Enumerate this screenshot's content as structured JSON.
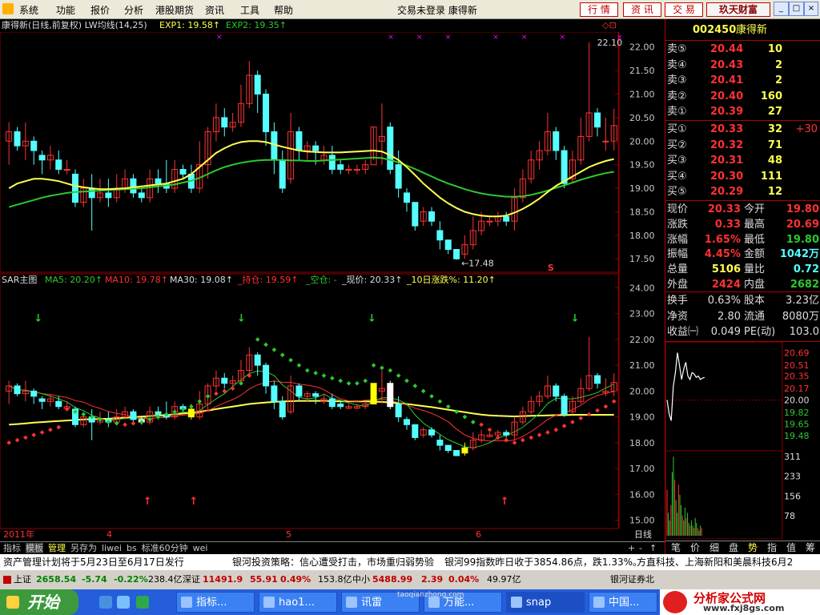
{
  "menu": {
    "items": [
      "系统",
      "功能",
      "报价",
      "分析",
      "港股期货",
      "资讯",
      "工具",
      "帮助"
    ],
    "center_text": "交易未登录  康得新",
    "buttons": [
      "行 情",
      "资 讯",
      "交 易"
    ],
    "brand": "玖天财富",
    "window_controls": [
      "_",
      "□",
      "×"
    ]
  },
  "chart_header": {
    "title": "康得新(日线,前复权) LW均线(14,25)",
    "exp1": "EXP1: 19.58↑",
    "exp2": "EXP2: 19.35↑",
    "corner_marks": "◇⊡",
    "max_label": "22.10",
    "min_label": "←17.48",
    "s_marker": "S"
  },
  "sar_header": {
    "title": "SAR主图",
    "ma5": "MA5: 20.20↑",
    "ma10": "MA10: 19.78↑",
    "ma30": "MA30: 19.08↑",
    "hold": "_持仓: 19.59↑",
    "empty": "_空仓: -",
    "price": "_现价: 20.33↑",
    "pct10": "_10日涨跌%: 11.20↑"
  },
  "axis": {
    "upper_ticks": [
      "22.00",
      "21.50",
      "21.00",
      "20.50",
      "20.00",
      "19.50",
      "19.00",
      "18.50",
      "18.00",
      "17.50"
    ],
    "lower_ticks": [
      "24.00",
      "23.00",
      "22.00",
      "21.00",
      "20.00",
      "19.00",
      "18.00",
      "17.00",
      "16.00",
      "15.00"
    ],
    "time_labels": [
      "2011年",
      "4",
      "5",
      "6"
    ],
    "timeframe": "日线",
    "nav_buttons": [
      "+",
      "-",
      "↑",
      "↓"
    ]
  },
  "bottom_tabs": [
    "指标",
    "模板",
    "管理",
    "另存为",
    "liwei",
    "bs",
    "标准60分钟",
    "wei"
  ],
  "quote": {
    "code": "002450",
    "name": "康得新",
    "asks": [
      {
        "label": "卖⑤",
        "price": "20.44",
        "vol": "10"
      },
      {
        "label": "卖④",
        "price": "20.43",
        "vol": "2"
      },
      {
        "label": "卖③",
        "price": "20.41",
        "vol": "2"
      },
      {
        "label": "卖②",
        "price": "20.40",
        "vol": "160"
      },
      {
        "label": "卖①",
        "price": "20.39",
        "vol": "27"
      }
    ],
    "bids": [
      {
        "label": "买①",
        "price": "20.33",
        "vol": "32",
        "chg": "+30"
      },
      {
        "label": "买②",
        "price": "20.32",
        "vol": "71",
        "chg": ""
      },
      {
        "label": "买③",
        "price": "20.31",
        "vol": "48",
        "chg": ""
      },
      {
        "label": "买④",
        "price": "20.30",
        "vol": "111",
        "chg": ""
      },
      {
        "label": "买⑤",
        "price": "20.29",
        "vol": "12",
        "chg": ""
      }
    ],
    "stats": [
      {
        "l1": "现价",
        "v1": "20.33",
        "l2": "今开",
        "v2": "19.80"
      },
      {
        "l1": "涨跌",
        "v1": "0.33",
        "l2": "最高",
        "v2": "20.69"
      },
      {
        "l1": "涨幅",
        "v1": "1.65%",
        "l2": "最低",
        "v2": "19.80"
      },
      {
        "l1": "振幅",
        "v1": "4.45%",
        "l2": "金额",
        "v2": "1042万"
      },
      {
        "l1": "总量",
        "v1": "5106",
        "l2": "量比",
        "v2": "0.72"
      },
      {
        "l1": "外盘",
        "v1": "2424",
        "l2": "内盘",
        "v2": "2682"
      }
    ],
    "fund": [
      {
        "l1": "换手",
        "v1": "0.63%",
        "l2": "股本",
        "v2": "3.23亿"
      },
      {
        "l1": "净资",
        "v1": "2.80",
        "l2": "流通",
        "v2": "8080万"
      },
      {
        "l1": "收益㈠",
        "v1": "0.049",
        "l2": "PE(动)",
        "v2": "103.0"
      }
    ],
    "mini_ticks": [
      "20.69",
      "20.51",
      "20.35",
      "20.17",
      "20.00",
      "19.82",
      "19.65",
      "19.48"
    ],
    "mini_vol_ticks": [
      "311",
      "233",
      "156",
      "78"
    ],
    "tabs": [
      "笔",
      "价",
      "细",
      "盘",
      "势",
      "指",
      "值",
      "筹"
    ]
  },
  "ticker": [
    "资产管理计划将于5月23日至6月17日发行",
    "银河投资策略：信心遭受打击，市场重归弱势验",
    "银河99指数昨日收于3854.86点，跌1.33%。",
    "方直科技、上海新阳和美晨科技6月2"
  ],
  "status": {
    "sh_label": "上证",
    "sh_val": "2658.54",
    "sh_chg": "-5.74",
    "sh_pct": "-0.22%",
    "sh_amt": "238.4亿",
    "sz_label": "深证",
    "sz_val": "11491.9",
    "sz_chg": "55.91",
    "sz_pct": "0.49%",
    "sz_amt": "153.8亿",
    "zx_label": "中小",
    "zx_val": "5488.99",
    "zx_chg": "2.39",
    "zx_pct": "0.04%",
    "zx_amt": "49.97亿",
    "broker": "银河证券北"
  },
  "taskbar": {
    "start": "开始",
    "tasks": [
      "指标...",
      "hao1...",
      "讯雷",
      "万能...",
      "snap",
      "中国..."
    ],
    "watermark_title": "分析家公式网",
    "watermark_url": "www.fxj8gs.com",
    "site_mark": "taoqianzhong.com"
  },
  "colors": {
    "up": "#ff3232",
    "down": "#54ffff",
    "ma_yellow": "#ffff50",
    "ma_green": "#2ec82e",
    "ma_white": "#ffffff",
    "ma_purple": "#ff00ff",
    "accent": "#c00000"
  },
  "chart_data": {
    "type": "candlestick",
    "title": "康得新(日线,前复权)",
    "candles": [
      [
        20.0,
        20.2,
        20.4,
        19.5
      ],
      [
        20.2,
        19.9,
        20.3,
        19.8
      ],
      [
        19.9,
        20.0,
        20.4,
        19.6
      ],
      [
        20.0,
        19.8,
        20.1,
        19.5
      ],
      [
        19.7,
        19.6,
        19.8,
        19.3
      ],
      [
        19.6,
        19.7,
        19.9,
        19.4
      ],
      [
        19.6,
        19.4,
        19.8,
        19.3
      ],
      [
        19.4,
        19.4,
        19.6,
        19.3
      ],
      [
        19.3,
        18.7,
        19.4,
        18.6
      ],
      [
        18.7,
        19.0,
        19.2,
        18.6
      ],
      [
        19.0,
        18.8,
        19.3,
        18.1
      ],
      [
        18.8,
        18.9,
        19.2,
        18.7
      ],
      [
        18.9,
        18.8,
        19.2,
        18.6
      ],
      [
        18.8,
        19.0,
        19.3,
        18.7
      ],
      [
        19.0,
        19.2,
        19.4,
        18.9
      ],
      [
        19.2,
        18.9,
        19.3,
        18.8
      ],
      [
        18.9,
        18.8,
        19.0,
        18.7
      ],
      [
        18.8,
        19.2,
        19.4,
        18.7
      ],
      [
        19.2,
        19.1,
        19.4,
        18.9
      ],
      [
        19.1,
        19.0,
        19.6,
        18.9
      ],
      [
        19.0,
        19.4,
        19.6,
        18.9
      ],
      [
        19.4,
        19.3,
        19.5,
        19.2
      ],
      [
        19.3,
        19.0,
        19.5,
        18.9
      ],
      [
        19.0,
        19.5,
        20.0,
        18.9
      ],
      [
        19.5,
        20.2,
        20.3,
        19.2
      ],
      [
        20.2,
        20.5,
        20.8,
        20.0
      ],
      [
        20.5,
        20.3,
        20.7,
        20.1
      ],
      [
        20.3,
        20.4,
        20.6,
        20.2
      ],
      [
        20.4,
        20.8,
        21.2,
        20.3
      ],
      [
        20.8,
        21.4,
        21.7,
        20.7
      ],
      [
        21.4,
        21.0,
        21.5,
        20.6
      ],
      [
        21.0,
        20.2,
        21.1,
        19.9
      ],
      [
        20.2,
        19.6,
        20.4,
        19.3
      ],
      [
        19.6,
        19.0,
        19.8,
        18.9
      ],
      [
        19.2,
        20.2,
        20.6,
        19.1
      ],
      [
        20.2,
        19.8,
        20.3,
        19.6
      ],
      [
        19.8,
        19.9,
        20.0,
        19.6
      ],
      [
        19.9,
        19.8,
        20.0,
        19.5
      ],
      [
        19.6,
        19.7,
        19.9,
        19.5
      ],
      [
        19.7,
        19.4,
        19.9,
        19.3
      ],
      [
        19.5,
        19.4,
        19.6,
        19.3
      ],
      [
        19.4,
        19.4,
        19.5,
        19.3
      ],
      [
        19.4,
        19.4,
        19.5,
        19.3
      ],
      [
        19.4,
        19.5,
        19.6,
        19.3
      ],
      [
        19.5,
        20.3,
        20.3,
        19.6
      ],
      [
        20.0,
        20.1,
        20.8,
        19.5
      ],
      [
        20.3,
        19.4,
        20.4,
        19.3
      ],
      [
        19.5,
        19.0,
        19.8,
        18.8
      ],
      [
        18.9,
        18.7,
        19.0,
        18.5
      ],
      [
        18.7,
        18.2,
        18.7,
        18.1
      ],
      [
        18.3,
        18.5,
        18.6,
        18.2
      ],
      [
        18.5,
        18.3,
        18.6,
        18.2
      ],
      [
        18.1,
        17.9,
        18.3,
        17.7
      ],
      [
        17.9,
        17.7,
        17.9,
        17.6
      ],
      [
        17.7,
        17.5,
        17.7,
        17.48
      ],
      [
        17.6,
        17.8,
        18.0,
        17.5
      ],
      [
        17.8,
        18.1,
        18.4,
        17.7
      ],
      [
        18.1,
        18.3,
        18.5,
        18.0
      ],
      [
        18.3,
        18.3,
        18.4,
        18.2
      ],
      [
        18.3,
        18.4,
        18.5,
        18.2
      ],
      [
        18.4,
        18.3,
        18.5,
        18.2
      ],
      [
        18.3,
        18.8,
        19.0,
        18.1
      ],
      [
        18.8,
        19.2,
        19.4,
        18.7
      ],
      [
        19.2,
        19.6,
        19.8,
        19.1
      ],
      [
        19.6,
        19.8,
        20.0,
        19.4
      ],
      [
        19.8,
        20.2,
        20.6,
        19.7
      ],
      [
        20.2,
        19.8,
        20.3,
        19.6
      ],
      [
        19.8,
        19.1,
        19.9,
        19.0
      ],
      [
        19.2,
        19.6,
        19.8,
        19.1
      ],
      [
        19.6,
        20.1,
        20.5,
        19.5
      ],
      [
        20.1,
        20.6,
        22.1,
        20.0
      ],
      [
        20.6,
        20.3,
        20.7,
        20.1
      ],
      [
        20.0,
        20.0,
        20.5,
        19.8
      ],
      [
        20.0,
        20.33,
        20.69,
        19.8
      ]
    ],
    "exp1": [
      19.0,
      19.1,
      19.15,
      19.2,
      19.2,
      19.18,
      19.15,
      19.1,
      19.05,
      19.02,
      19.0,
      18.98,
      18.98,
      18.99,
      19.0,
      19.02,
      19.04,
      19.06,
      19.08,
      19.1,
      19.15,
      19.2,
      19.3,
      19.45,
      19.6,
      19.75,
      19.85,
      19.93,
      19.98,
      20.0,
      20.0,
      19.98,
      19.93,
      19.88,
      19.84,
      19.8,
      19.78,
      19.77,
      19.76,
      19.76,
      19.76,
      19.77,
      19.78,
      19.79,
      19.8,
      19.78,
      19.7,
      19.6,
      19.45,
      19.28,
      19.1,
      18.95,
      18.8,
      18.68,
      18.58,
      18.5,
      18.45,
      18.42,
      18.4,
      18.4,
      18.42,
      18.48,
      18.56,
      18.66,
      18.78,
      18.92,
      19.05,
      19.15,
      19.25,
      19.35,
      19.45,
      19.52,
      19.58,
      19.62
    ],
    "exp2": [
      18.6,
      18.65,
      18.7,
      18.75,
      18.8,
      18.84,
      18.87,
      18.9,
      18.92,
      18.93,
      18.94,
      18.95,
      18.96,
      18.97,
      18.98,
      18.99,
      19.0,
      19.02,
      19.04,
      19.06,
      19.08,
      19.12,
      19.16,
      19.22,
      19.3,
      19.38,
      19.45,
      19.5,
      19.54,
      19.57,
      19.59,
      19.6,
      19.6,
      19.6,
      19.59,
      19.59,
      19.58,
      19.58,
      19.59,
      19.6,
      19.61,
      19.62,
      19.63,
      19.64,
      19.65,
      19.64,
      19.6,
      19.55,
      19.48,
      19.41,
      19.33,
      19.25,
      19.17,
      19.1,
      19.04,
      18.98,
      18.93,
      18.89,
      18.86,
      18.84,
      18.82,
      18.82,
      18.83,
      18.86,
      18.9,
      18.95,
      19.01,
      19.06,
      19.12,
      19.18,
      19.23,
      19.28,
      19.32,
      19.35
    ],
    "sar": [
      18.0,
      18.1,
      18.2,
      18.3,
      18.4,
      18.5,
      18.6,
      19.3,
      19.2,
      19.1,
      19.0,
      18.9,
      18.8,
      18.75,
      18.7,
      18.75,
      18.8,
      18.9,
      19.0,
      19.1,
      19.2,
      19.3,
      19.4,
      19.6,
      19.8,
      19.9,
      20.0,
      20.1,
      20.3,
      20.6,
      22.0,
      21.8,
      21.6,
      21.4,
      21.2,
      21.0,
      20.8,
      20.7,
      20.6,
      20.5,
      20.4,
      20.3,
      20.3,
      20.4,
      21.0,
      20.9,
      20.8,
      20.6,
      20.4,
      20.2,
      20.0,
      19.8,
      19.6,
      19.4,
      19.2,
      19.0,
      18.8,
      18.7,
      18.5,
      18.2,
      18.1,
      18.0,
      18.1,
      18.2,
      18.3,
      18.4,
      18.5,
      18.65,
      18.8,
      18.95,
      19.1,
      19.25,
      19.4,
      19.6
    ],
    "ma30_lower": [
      18.7,
      18.72,
      18.75,
      18.78,
      18.8,
      18.82,
      18.84,
      18.86,
      18.88,
      18.9,
      18.91,
      18.92,
      18.93,
      18.95,
      18.97,
      18.99,
      19.01,
      19.03,
      19.05,
      19.07,
      19.1,
      19.13,
      19.16,
      19.2,
      19.25,
      19.3,
      19.35,
      19.4,
      19.45,
      19.5,
      19.53,
      19.56,
      19.58,
      19.6,
      19.61,
      19.62,
      19.62,
      19.62,
      19.62,
      19.61,
      19.6,
      19.6,
      19.6,
      19.6,
      19.59,
      19.58,
      19.56,
      19.53,
      19.5,
      19.46,
      19.42,
      19.38,
      19.33,
      19.28,
      19.23,
      19.18,
      19.13,
      19.09,
      19.06,
      19.04,
      19.03,
      19.02,
      19.03,
      19.04,
      19.05,
      19.06,
      19.07,
      19.07,
      19.08,
      19.08,
      19.08,
      19.08,
      19.08,
      19.08
    ],
    "buy_arrows": [
      12,
      16,
      43,
      62
    ],
    "sell_arrows": [
      2,
      16,
      25,
      39
    ],
    "upper_ylim": [
      17.3,
      22.25
    ],
    "lower_ylim": [
      14.8,
      24.2
    ],
    "mini_chart": [
      20.0,
      19.8,
      19.7,
      20.2,
      20.4,
      20.69,
      20.5,
      20.3,
      20.45,
      20.55,
      20.35,
      20.3,
      20.4,
      20.38,
      20.33,
      20.35,
      20.3,
      20.32,
      20.33
    ],
    "mini_ylim": [
      19.4,
      20.8
    ],
    "mini_vol": [
      180,
      90,
      60,
      120,
      250,
      310,
      220,
      140,
      90,
      200,
      160,
      120,
      80,
      60,
      110,
      70,
      90,
      50,
      40,
      60,
      40,
      30,
      70,
      50,
      30,
      20,
      40,
      30
    ]
  }
}
